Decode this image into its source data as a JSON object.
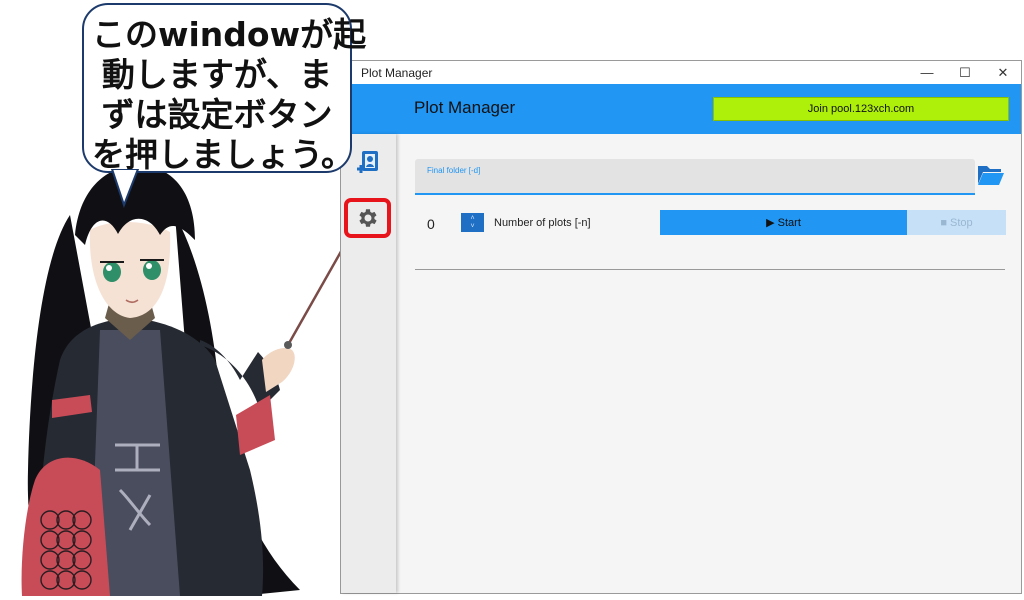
{
  "speech_bubble": {
    "lines": [
      "このwindowが起",
      "動しますが、ま",
      "ずは設定ボタン",
      "を押しましょう。"
    ]
  },
  "window": {
    "title": "Plot Manager",
    "controls": {
      "minimize": "—",
      "maximize": "☐",
      "close": "✕"
    }
  },
  "header": {
    "title": "Plot Manager",
    "join_label": "Join pool.123xch.com"
  },
  "sidebar": {
    "items": [
      {
        "icon": "plot-add-icon"
      },
      {
        "icon": "gear-icon",
        "highlighted": true
      }
    ]
  },
  "form": {
    "final_folder_label": "Final folder [-d]",
    "final_folder_value": "",
    "plot_count": "0",
    "stepper_up": "˄",
    "stepper_down": "˅",
    "plots_label": "Number of plots [-n]",
    "start_label": "▶ Start",
    "stop_label": "■ Stop"
  },
  "colors": {
    "header": "#2196f3",
    "join_button": "#aef00a",
    "start_button": "#2196f3",
    "stop_button": "#c6e0f8",
    "highlight": "#e8141b"
  }
}
